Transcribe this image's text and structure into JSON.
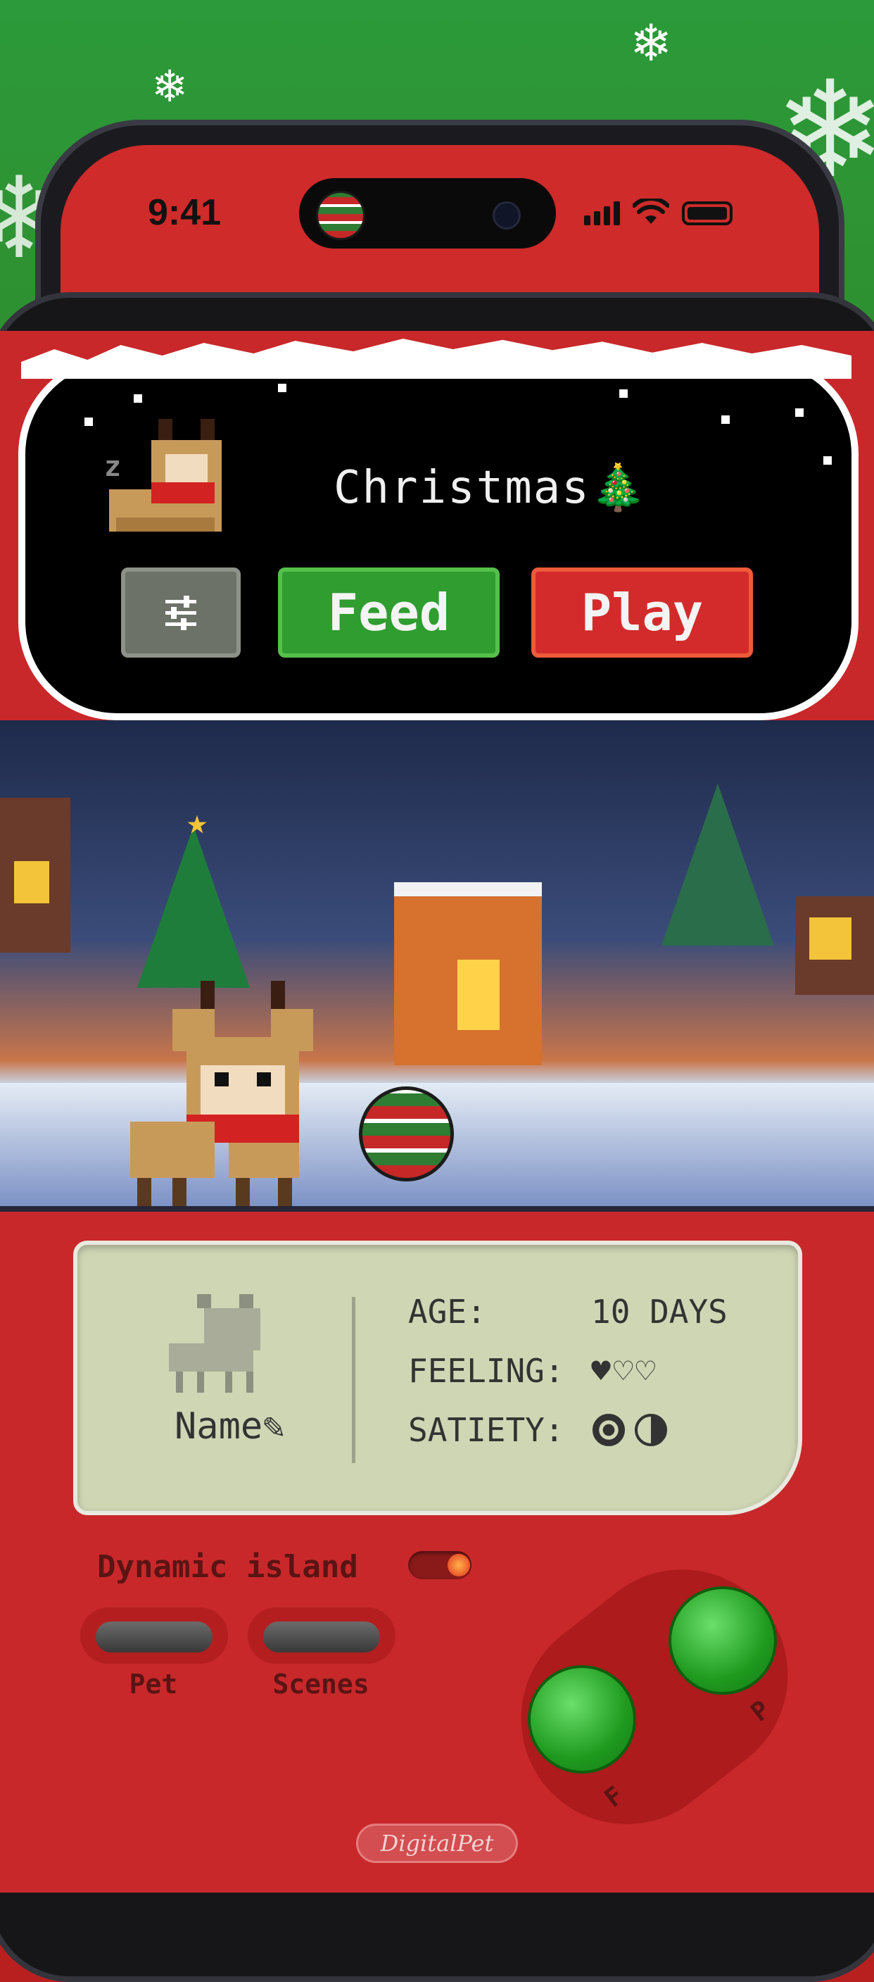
{
  "status_bar": {
    "time": "9:41"
  },
  "dynamic_island": {
    "title": "Christmas🎄",
    "feed_label": "Feed",
    "play_label": "Play",
    "sleep_indicator": "z"
  },
  "stats": {
    "pet_name": "Name",
    "age_label": "AGE:",
    "age_value": "10 DAYS",
    "feeling_label": "FEELING:",
    "feeling_value": "♥♡♡",
    "feeling_level": "1 of 3",
    "satiety_label": "SATIETY:",
    "satiety_level": "1.5 of 2"
  },
  "controls": {
    "dynamic_island_toggle_label": "Dynamic island",
    "dynamic_island_toggle_on": true,
    "pet_label": "Pet",
    "scenes_label": "Scenes",
    "button_f_label": "F",
    "button_p_label": "P"
  },
  "brand": "DigitalPet",
  "colors": {
    "accent_red": "#c8282a",
    "feed_green": "#2f9d2f",
    "play_red": "#d32b2b",
    "lcd_bg": "#cfd6b4",
    "top_green": "#2c9a3a"
  },
  "icons": [
    "snowflake-icon",
    "signal-icon",
    "wifi-icon",
    "battery-icon",
    "settings-sliders-icon",
    "pencil-icon",
    "heart-icon",
    "christmas-ornament-icon",
    "reindeer-pet"
  ]
}
